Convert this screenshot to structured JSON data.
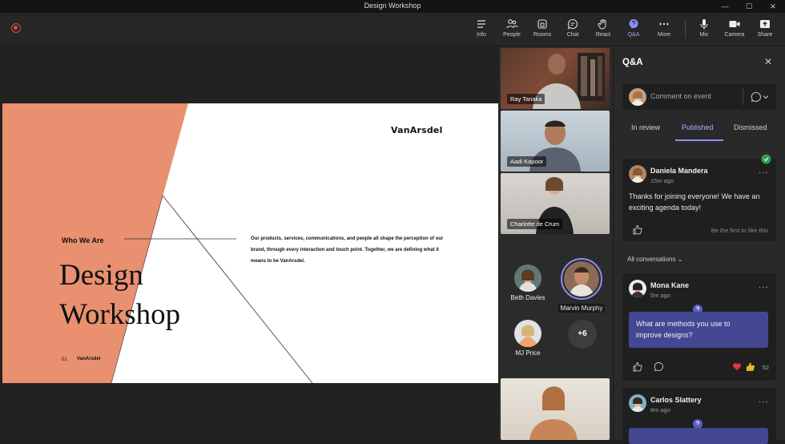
{
  "window": {
    "title": "Design Workshop",
    "minimize": "—",
    "maximize": "☐",
    "close": "✕"
  },
  "toolbar": {
    "items": [
      {
        "label": "Info",
        "icon": "info-icon"
      },
      {
        "label": "People",
        "icon": "people-icon"
      },
      {
        "label": "Rooms",
        "icon": "rooms-icon"
      },
      {
        "label": "Chat",
        "icon": "chat-icon"
      },
      {
        "label": "React",
        "icon": "react-hand-icon"
      },
      {
        "label": "Q&A",
        "icon": "qa-icon",
        "active": true
      },
      {
        "label": "More",
        "icon": "more-icon"
      },
      {
        "label": "Mic",
        "icon": "mic-icon"
      },
      {
        "label": "Camera",
        "icon": "camera-icon"
      },
      {
        "label": "Share",
        "icon": "share-icon"
      }
    ]
  },
  "slide": {
    "brand": "VanArsdel",
    "section": "Who We Are",
    "title_line1": "Design",
    "title_line2": "Workshop",
    "description": "Our products, services, communications, and people all shape the perception of our brand, through every interaction and touch point. Together, we are defining what it means to be VanArsdel.",
    "page_number": "01",
    "footer_brand": "VanArsdel",
    "accent_color": "#e8906f"
  },
  "participants": {
    "videos": [
      {
        "name": "Ray Tanaka"
      },
      {
        "name": "Aadi Kapoor"
      },
      {
        "name": "Charlotte de Crum"
      }
    ],
    "avatars": [
      {
        "name": "Beth Davies"
      },
      {
        "name": "Marvin Murphy"
      },
      {
        "name": "MJ Price"
      }
    ],
    "overflow_count": "+6"
  },
  "qa": {
    "title": "Q&A",
    "comment_placeholder": "Comment on event",
    "tabs": [
      "In review",
      "Published",
      "Dismissed"
    ],
    "active_tab": "Published",
    "filter_label": "All conversations",
    "posts": [
      {
        "author": "Daniela Mandera",
        "time": "15m ago",
        "text_line1": "Thanks for joining everyone! We have an",
        "text_line2": "exciting agenda today!",
        "footer_note": "Be the first to like this"
      },
      {
        "author": "Mona Kane",
        "time": "5m ago",
        "question_line1": "What are methods you use to",
        "question_line2": "improve designs?",
        "reaction_count": "52"
      },
      {
        "author": "Carlos Slattery",
        "time": "8m ago"
      }
    ]
  }
}
